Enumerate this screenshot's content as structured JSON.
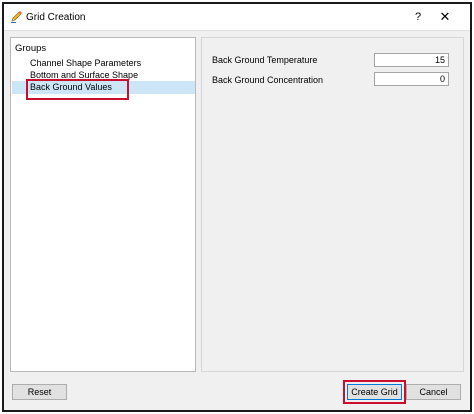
{
  "window": {
    "title": "Grid Creation",
    "help_glyph": "?",
    "close_glyph": "✕"
  },
  "groups": {
    "header": "Groups",
    "items": [
      {
        "label": "Channel Shape Parameters"
      },
      {
        "label": "Bottom and Surface Shape"
      },
      {
        "label": "Back Ground Values"
      }
    ],
    "selected_index": 2
  },
  "params": {
    "rows": [
      {
        "label": "Back Ground Temperature",
        "value": "15"
      },
      {
        "label": "Back Ground Concentration",
        "value": "0"
      }
    ]
  },
  "footer": {
    "reset_label": "Reset",
    "create_label": "Create Grid",
    "cancel_label": "Cancel"
  },
  "colors": {
    "selection": "#cce6f7",
    "highlight": "#c8102e",
    "accent": "#0078d7"
  },
  "icons": {
    "app": "pencil-icon"
  }
}
